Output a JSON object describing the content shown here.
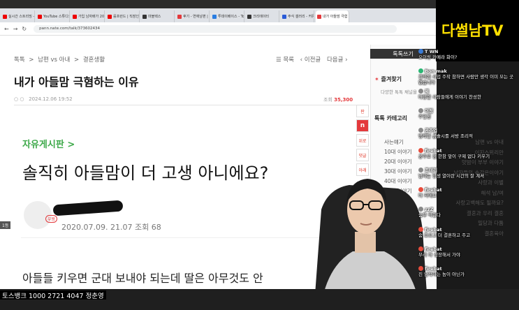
{
  "browser": {
    "tabs": [
      {
        "label": "실시간 스트리밍 - YouTube",
        "color": "#e00"
      },
      {
        "label": "YouTube 스튜디오",
        "color": "#e00"
      },
      {
        "label": "가입 남자배가 20대 제외 결과",
        "color": "#e00"
      },
      {
        "label": "를프런드 | 직장인 기업 연봉",
        "color": "#e00"
      },
      {
        "label": "마블렉스",
        "color": "#333"
      },
      {
        "label": "후기 - 연애남편 | 네이트판",
        "color": "#e4393c"
      },
      {
        "label": "투데이베이스 - Toonation",
        "color": "#2a7de1"
      },
      {
        "label": "크리에이터",
        "color": "#333"
      },
      {
        "label": "주식 갤러리 - 커뮤니티 포털",
        "color": "#2a5bd7"
      },
      {
        "label": "내가 아들맘 극혐",
        "color": "#e4393c"
      }
    ],
    "url": "pann.nate.com/talk/373602434"
  },
  "page": {
    "breadcrumb": [
      "톡톡",
      "남편 vs 아내",
      "결혼생활"
    ],
    "nav": {
      "list": "목록",
      "prev": "이전글",
      "next": "다음글"
    },
    "title": "내가 아들맘 극혐하는 이유",
    "date": "2024.12.06 19:52",
    "views_label": "조회",
    "views": "35,300",
    "board": "자유게시판",
    "post_title": "솔직히 아들맘이 더 고생 아니에요?",
    "post_meta": "2020.07.09. 21.07 조회 68",
    "badge": "1등",
    "badge2": "우왕",
    "body_line": "아들들 키우면 군대 보내야 되는데 딸은 아무것도 안"
  },
  "side_icons": [
    "판",
    "n",
    "위로",
    "댓글",
    "아래"
  ],
  "side_panel": {
    "header": "톡톡쓰기",
    "favorites": "즐겨찾기",
    "fav_desc": "다양한 톡톡 채널을",
    "category": "톡톡 카테고리",
    "items": [
      "사는얘기",
      "10대 이야기",
      "20대 이야기",
      "30대 이야기",
      "40대 이야기",
      "50대 이야기",
      "남편 vs 아내",
      "이지스위리만",
      "맛밤이 부부 이야기",
      "남자들의 속감은이야기",
      "사랑과 이별",
      "해석 남/여",
      "사랑고백해도 될까요?",
      "결혼과 우리 결혼",
      "밀당과 다툼",
      "결혼육아"
    ]
  },
  "stream": {
    "logo": "다썰남TV",
    "donation": "토스뱅크 1000 2721 4047 정춘영",
    "chat": [
      {
        "name": "T WN",
        "msg": "오이링 카메라 화이?",
        "color": "#3a7bd5"
      },
      {
        "name": "Bon mak",
        "msg": "건의된 사업 주작 참하면 사람만 생각 이미 모는 곳 없습니다",
        "color": "#2bb673"
      },
      {
        "name": "제",
        "msg": "다양한 사람들에게 이야기 찬성한",
        "color": "#888"
      },
      {
        "name": "이정",
        "msg": "주인공",
        "color": "#888"
      },
      {
        "name": "공주업",
        "msg": "명작인 곰솔시를 서방 조리적",
        "color": "#888"
      },
      {
        "name": "firebat",
        "msg": "공주로 점 한참 앞이 구제 없다 키우기",
        "color": "#e74c3c"
      },
      {
        "name": "조테리",
        "msg": "남자는 양생 열이란 시간의 잘 계셔",
        "color": "#888"
      },
      {
        "name": "firebat",
        "msg": "다 저예요",
        "color": "#e74c3c"
      },
      {
        "name": "zzZ",
        "msg": "숨무 막힌다",
        "color": "#888"
      },
      {
        "name": "firebat",
        "msg": "숨 조르고 더 결혼하고 주고",
        "color": "#e74c3c"
      },
      {
        "name": "firebat",
        "msg": "무리 다 성장해서 가야",
        "color": "#e74c3c"
      },
      {
        "name": "firebat",
        "msg": "진 남작하는 놈이 아닌가",
        "color": "#e74c3c"
      }
    ]
  }
}
